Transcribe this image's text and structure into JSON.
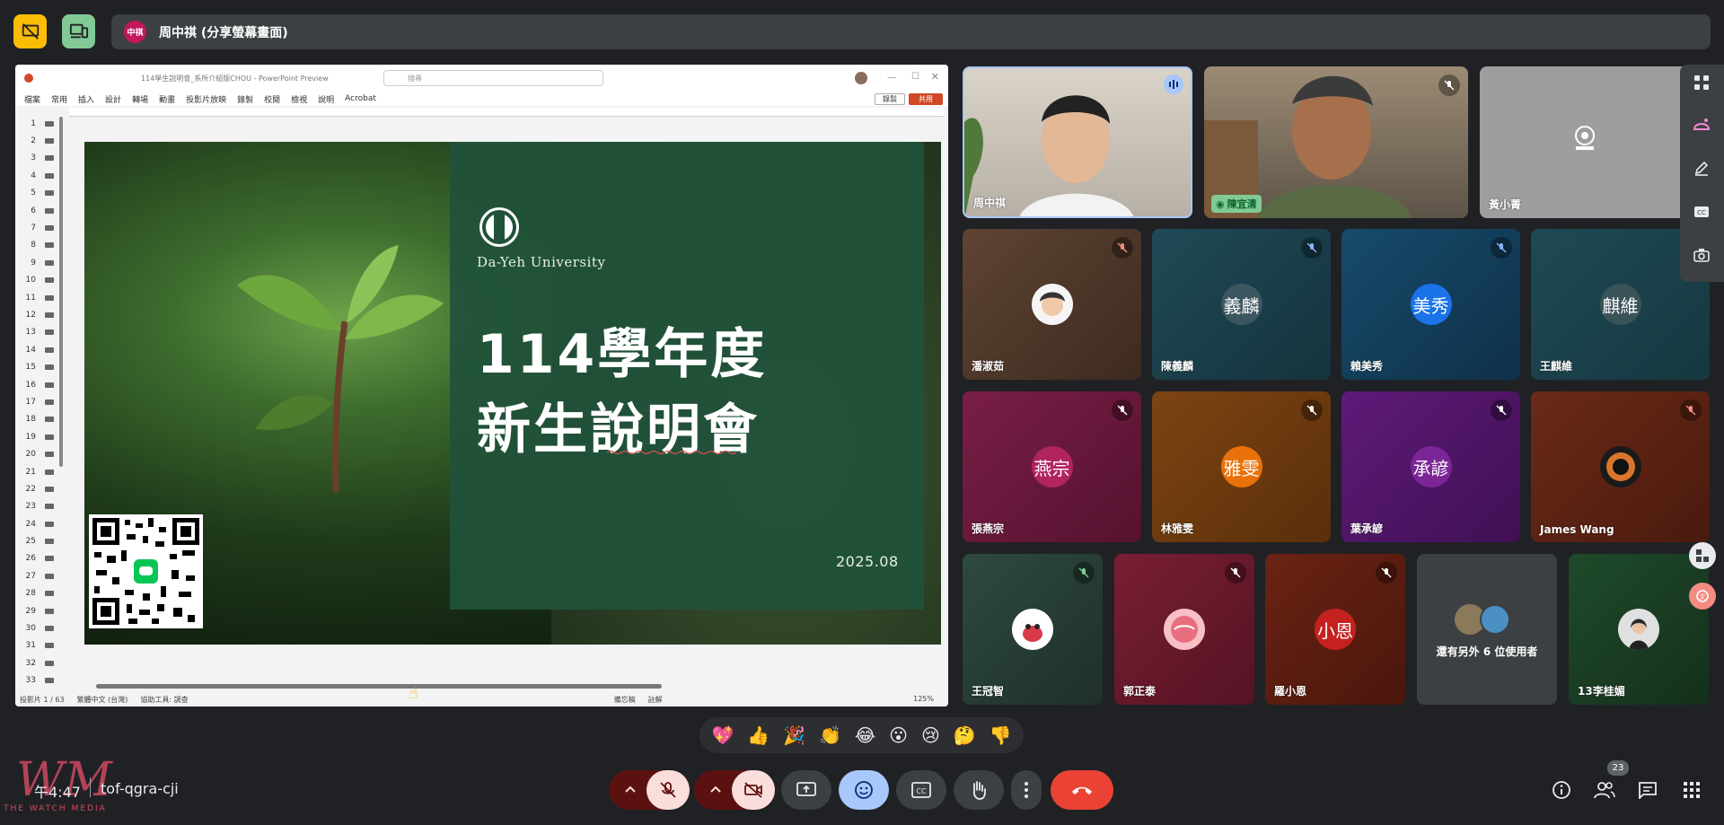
{
  "presenter": {
    "avatar_label": "中祺",
    "bar_text": "周中祺 (分享螢幕畫面)"
  },
  "ppt": {
    "file_title": "114學生說明會_系所介紹版CHOU  -  PowerPoint Preview",
    "search_placeholder": "搜尋",
    "ribbon_tabs": [
      "檔案",
      "常用",
      "插入",
      "設計",
      "轉場",
      "動畫",
      "投影片放映",
      "錄製",
      "校閱",
      "檢視",
      "說明",
      "Acrobat"
    ],
    "record_label": "錄製",
    "share_label": "共用",
    "thumb_numbers": [
      "1",
      "2",
      "3",
      "4",
      "5",
      "6",
      "7",
      "8",
      "9",
      "10",
      "11",
      "12",
      "13",
      "14",
      "15",
      "16",
      "17",
      "18",
      "19",
      "20",
      "21",
      "22",
      "23",
      "24",
      "25",
      "26",
      "27",
      "28",
      "29",
      "30",
      "31",
      "32",
      "33"
    ],
    "status_items": [
      "投影片 1 / 63",
      "繁體中文 (台灣)",
      "協助工具: 調查"
    ],
    "status_right": [
      "備忘稿",
      "註解"
    ],
    "zoom": "125%"
  },
  "slide": {
    "university": "Da-Yeh University",
    "title_line1": "114學年度",
    "title_line2": "新生說明會",
    "date": "2025.08"
  },
  "participants": [
    {
      "name": "周中祺",
      "speaking": true
    },
    {
      "name": "陳宜清",
      "mic_on": true
    },
    {
      "name": "黃小菁"
    },
    {
      "name": "潘淑茹",
      "muted": true
    },
    {
      "name": "陳義麟",
      "initials": "義麟",
      "muted": true
    },
    {
      "name": "賴美秀",
      "initials": "美秀",
      "muted": true
    },
    {
      "name": "王麒維",
      "initials": "麒維",
      "muted": true
    },
    {
      "name": "張燕宗",
      "initials": "燕宗",
      "muted": true
    },
    {
      "name": "林雅雯",
      "initials": "雅雯",
      "muted": true
    },
    {
      "name": "葉承諺",
      "initials": "承諺",
      "muted": true
    },
    {
      "name": "James Wang",
      "muted": true
    },
    {
      "name": "王冠智",
      "muted": true
    },
    {
      "name": "郭正泰",
      "muted": true
    },
    {
      "name": "羅小恩",
      "initials": "小恩",
      "muted": true
    },
    {
      "name": "13李桂媚",
      "muted": true
    }
  ],
  "others_label": "還有另外 6 位使用者",
  "reactions": [
    "💖",
    "👍",
    "🎉",
    "👏",
    "😂",
    "😮",
    "😢",
    "🤔",
    "👎"
  ],
  "meeting": {
    "time": "午4:47",
    "code": "tof-qgra-cji"
  },
  "people_count": "23",
  "watermark": {
    "logo": "WM",
    "subtitle": "THE WATCH MEDIA"
  },
  "colors": {
    "accent_blue": "#a8c7fa",
    "end_call": "#ea4335",
    "muted_red": "#f9dedc",
    "slide_green": "#20523a"
  }
}
